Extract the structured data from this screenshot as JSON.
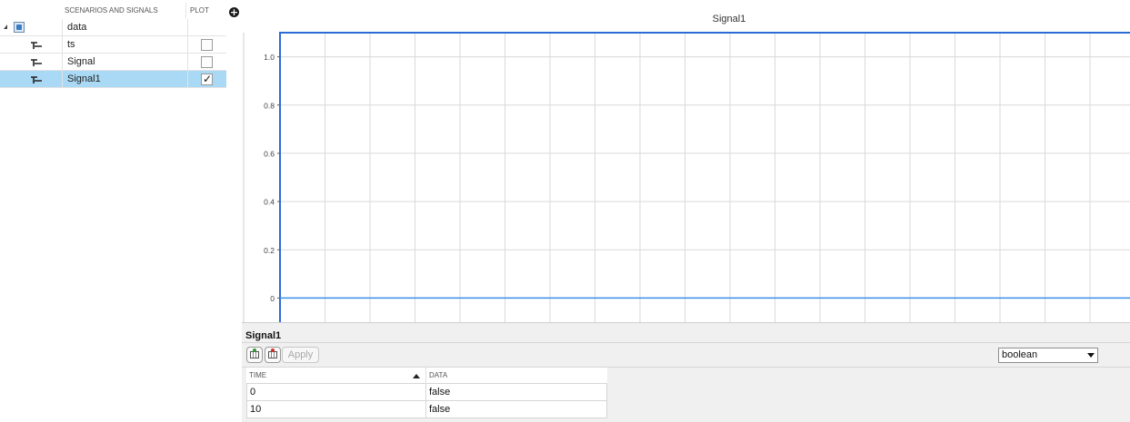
{
  "tree": {
    "headers": {
      "name": "SCENARIOS AND SIGNALS",
      "plot": "PLOT"
    },
    "rows": [
      {
        "name": "data",
        "kind": "dataset",
        "expandable": true,
        "selected": false
      },
      {
        "name": "ts",
        "kind": "signal",
        "plot": false,
        "selected": false
      },
      {
        "name": "Signal",
        "kind": "signal",
        "plot": false,
        "selected": false
      },
      {
        "name": "Signal1",
        "kind": "signal",
        "plot": true,
        "selected": true
      }
    ],
    "checkmark": "✓"
  },
  "add_button_glyph": "+",
  "chart_data": {
    "type": "line",
    "title": "Signal1",
    "xlabel": "",
    "ylabel": "",
    "yticks": [
      "1.0",
      "0.8",
      "0.6",
      "0.4",
      "0.2",
      "0"
    ],
    "ylim": [
      -0.1,
      1.1
    ],
    "grid": true,
    "series": [
      {
        "x": [
          0,
          0,
          10
        ],
        "y": [
          -0.1,
          1.1,
          1.1
        ],
        "color": "#2a6bd8"
      },
      {
        "x": [
          0,
          10
        ],
        "y": [
          0,
          0
        ],
        "color": "#3b8fe8"
      }
    ]
  },
  "editor": {
    "title": "Signal1",
    "apply_label": "Apply",
    "type_value": "boolean",
    "columns": {
      "time": "TIME",
      "data": "DATA"
    },
    "rows": [
      {
        "time": "0",
        "data": "false"
      },
      {
        "time": "10",
        "data": "false"
      }
    ]
  },
  "colors": {
    "selection": "#a9d9f5",
    "signal_line": "#2a6bd8",
    "grid": "#d9d9d9"
  }
}
